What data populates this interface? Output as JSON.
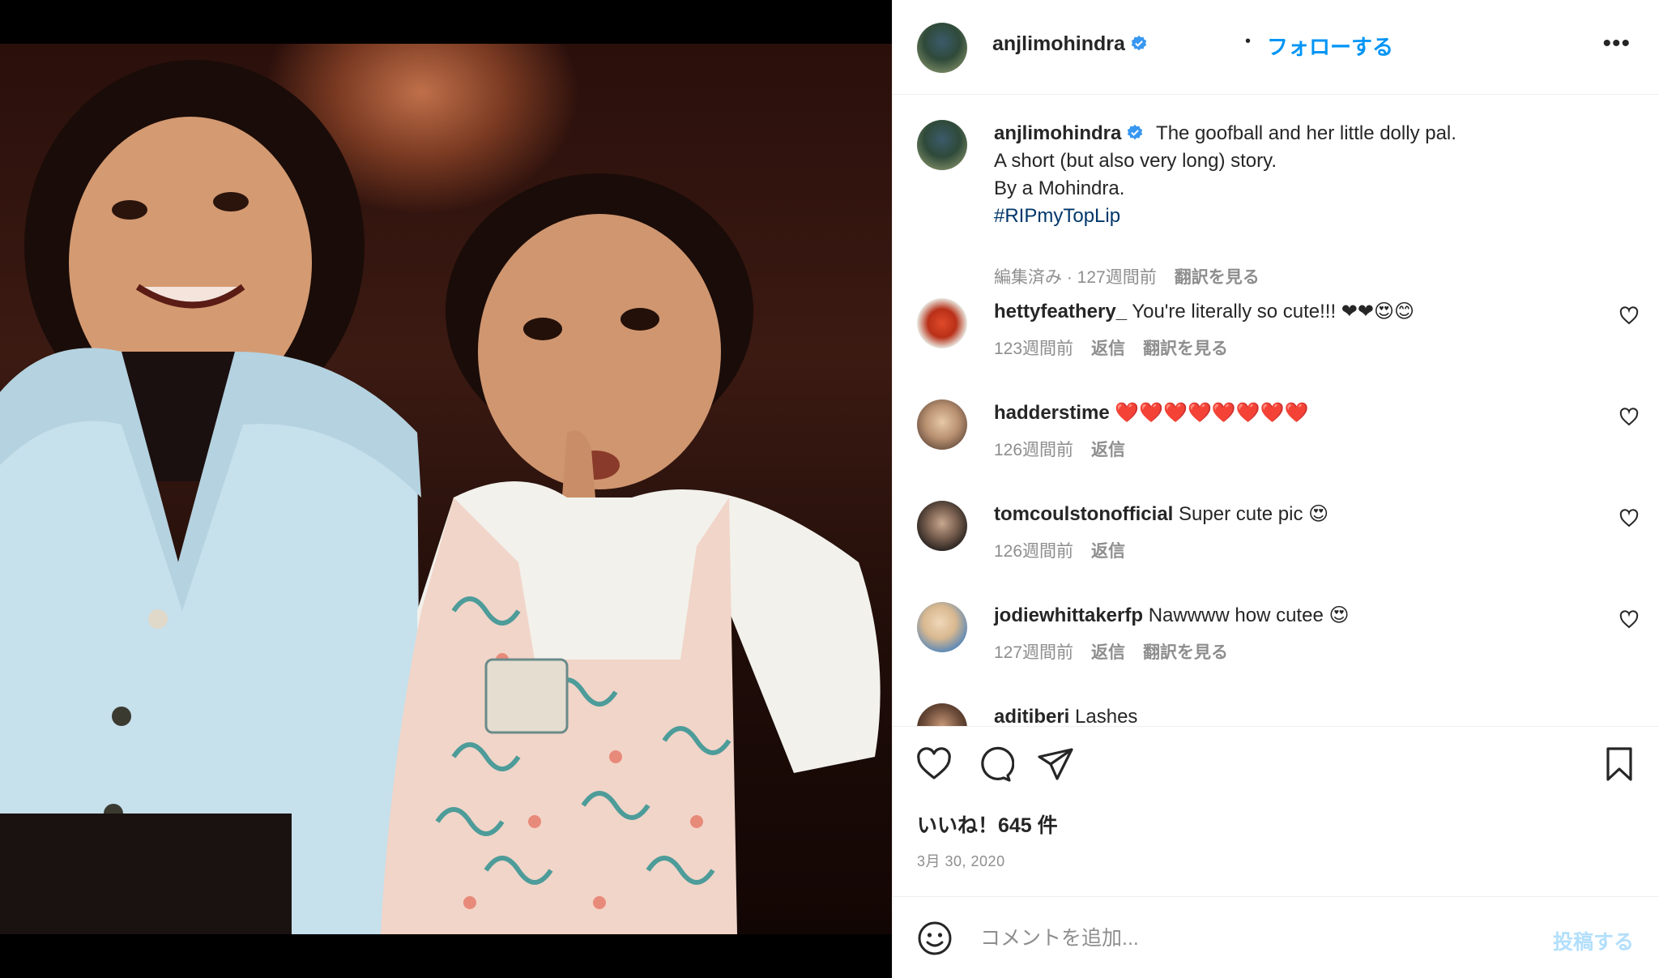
{
  "photo": {
    "alt_icon": "photo-two-children",
    "colors": {
      "background": "#000000",
      "cardigan": "#c6e0ec",
      "overall": "#f3d9cf"
    }
  },
  "header": {
    "username": "anjlimohindra",
    "separator": "•",
    "follow_label": "フォローする",
    "more_icon": "more-options-icon",
    "more_label": "•••"
  },
  "caption": {
    "username": "anjlimohindra",
    "line1": "The goofball and her little dolly pal.",
    "line2": "A short (but also very long) story.",
    "line3": "By a Mohindra.",
    "hashtag": "#RIPmyTopLip",
    "edited": "編集済み · 127週間前",
    "translate": "翻訳を見る"
  },
  "comments": [
    {
      "username": "hettyfeathery_",
      "text": "You're literally so cute!!! ❤❤😍😊",
      "time": "123週間前",
      "reply": "返信",
      "translate": "翻訳を見る"
    },
    {
      "username": "hadderstime",
      "text": "❤️❤️❤️❤️❤️❤️❤️❤️",
      "time": "126週間前",
      "reply": "返信"
    },
    {
      "username": "tomcoulstonofficial",
      "text": "Super cute pic 😍",
      "time": "126週間前",
      "reply": "返信"
    },
    {
      "username": "jodiewhittakerfp",
      "text": "Nawwww how cutee 😍",
      "time": "127週間前",
      "reply": "返信",
      "translate": "翻訳を見る"
    },
    {
      "username": "aditiberi",
      "text": "Lashes"
    }
  ],
  "actions": {
    "likes": "いいね！645 件",
    "date": "3月 30, 2020"
  },
  "comment_bar": {
    "placeholder": "コメントを追加...",
    "post_label": "投稿する"
  },
  "colors": {
    "accent": "#0095f6",
    "verified": "#3897f0",
    "hashtag": "#00376b",
    "muted": "#8e8e8e"
  }
}
